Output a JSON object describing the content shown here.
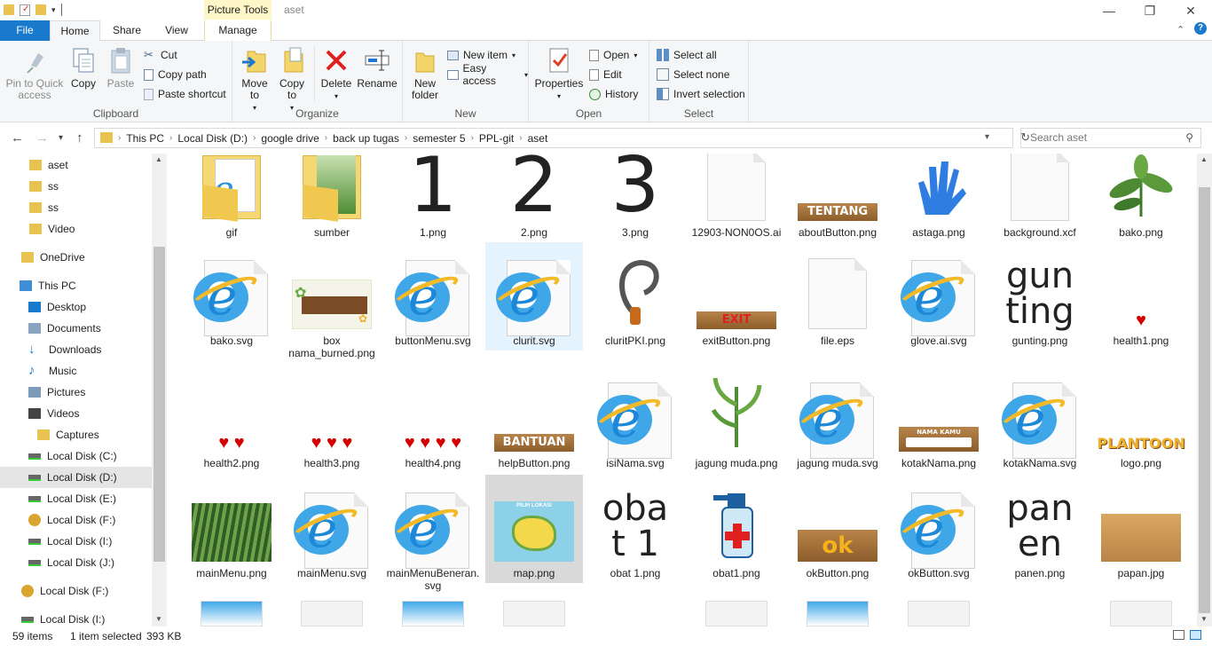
{
  "window": {
    "title": "aset",
    "context_tab": "Picture Tools",
    "minimize": "—",
    "restore": "❐",
    "close": "✕"
  },
  "tabs": [
    "File",
    "Home",
    "Share",
    "View",
    "Manage"
  ],
  "ribbon": {
    "clipboard": {
      "label": "Clipboard",
      "pin": "Pin to Quick access",
      "copy": "Copy",
      "paste": "Paste",
      "cut": "Cut",
      "copy_path": "Copy path",
      "paste_shortcut": "Paste shortcut"
    },
    "organize": {
      "label": "Organize",
      "move_to": "Move to",
      "copy_to": "Copy to",
      "delete": "Delete",
      "rename": "Rename"
    },
    "new": {
      "label": "New",
      "new_folder": "New folder",
      "new_item": "New item",
      "easy_access": "Easy access"
    },
    "open": {
      "label": "Open",
      "properties": "Properties",
      "open": "Open",
      "edit": "Edit",
      "history": "History"
    },
    "select": {
      "label": "Select",
      "select_all": "Select all",
      "select_none": "Select none",
      "invert": "Invert selection"
    }
  },
  "address": {
    "crumbs": [
      "This PC",
      "Local Disk (D:)",
      "google drive",
      "back up tugas",
      "semester 5",
      "PPL-git",
      "aset"
    ],
    "search_placeholder": "Search aset"
  },
  "nav": [
    {
      "label": "aset",
      "icon": "folder-icon"
    },
    {
      "label": "ss",
      "icon": "folder-icon"
    },
    {
      "label": "ss",
      "icon": "folder-icon"
    },
    {
      "label": "Video",
      "icon": "folder-icon"
    },
    {
      "label": "OneDrive",
      "icon": "folder-icon"
    },
    {
      "label": "This PC",
      "icon": "computer-icon"
    },
    {
      "label": "Desktop",
      "icon": "desktop-icon"
    },
    {
      "label": "Documents",
      "icon": "documents-icon"
    },
    {
      "label": "Downloads",
      "icon": "downloads-icon"
    },
    {
      "label": "Music",
      "icon": "music-icon"
    },
    {
      "label": "Pictures",
      "icon": "pictures-icon"
    },
    {
      "label": "Videos",
      "icon": "videos-icon"
    },
    {
      "label": "Captures",
      "icon": "folder-icon"
    },
    {
      "label": "Local Disk (C:)",
      "icon": "drive-icon"
    },
    {
      "label": "Local Disk (D:)",
      "icon": "drive-icon"
    },
    {
      "label": "Local Disk (E:)",
      "icon": "drive-icon"
    },
    {
      "label": "Local Disk (F:)",
      "icon": "disc-icon"
    },
    {
      "label": "Local Disk (I:)",
      "icon": "drive-icon"
    },
    {
      "label": "Local Disk (J:)",
      "icon": "drive-icon"
    },
    {
      "label": "Local Disk (F:)",
      "icon": "disc-icon"
    },
    {
      "label": "Local Disk (I:)",
      "icon": "drive-icon"
    }
  ],
  "files": [
    {
      "name": "gif",
      "thumb": "folder-ie"
    },
    {
      "name": "sumber",
      "thumb": "folder-plant"
    },
    {
      "name": "1.png",
      "thumb": "text",
      "text": "1"
    },
    {
      "name": "2.png",
      "thumb": "text",
      "text": "2"
    },
    {
      "name": "3.png",
      "thumb": "text",
      "text": "3"
    },
    {
      "name": "12903-NON0OS.ai",
      "thumb": "blank"
    },
    {
      "name": "aboutButton.png",
      "thumb": "wood",
      "text": "TENTANG"
    },
    {
      "name": "astaga.png",
      "thumb": "glove"
    },
    {
      "name": "background.xcf",
      "thumb": "blank"
    },
    {
      "name": "bako.png",
      "thumb": "plant"
    },
    {
      "name": "bako.svg",
      "thumb": "ie"
    },
    {
      "name": "box nama_burned.png",
      "thumb": "board"
    },
    {
      "name": "buttonMenu.svg",
      "thumb": "ie"
    },
    {
      "name": "clurit.svg",
      "thumb": "ie"
    },
    {
      "name": "cluritPKI.png",
      "thumb": "sickle"
    },
    {
      "name": "exitButton.png",
      "thumb": "wood",
      "text": "EXIT"
    },
    {
      "name": "file.eps",
      "thumb": "blank"
    },
    {
      "name": "glove.ai.svg",
      "thumb": "ie"
    },
    {
      "name": "gunting.png",
      "thumb": "bigtext",
      "text": "gun ting"
    },
    {
      "name": "health1.png",
      "thumb": "hearts",
      "text": "♥"
    },
    {
      "name": "health2.png",
      "thumb": "hearts",
      "text": "♥ ♥"
    },
    {
      "name": "health3.png",
      "thumb": "hearts",
      "text": "♥ ♥ ♥"
    },
    {
      "name": "health4.png",
      "thumb": "hearts",
      "text": "♥ ♥ ♥ ♥"
    },
    {
      "name": "helpButton.png",
      "thumb": "wood",
      "text": "BANTUAN"
    },
    {
      "name": "isiNama.svg",
      "thumb": "ie"
    },
    {
      "name": "jagung muda.png",
      "thumb": "corn"
    },
    {
      "name": "jagung muda.svg",
      "thumb": "ie"
    },
    {
      "name": "kotakNama.png",
      "thumb": "woodbox",
      "text": "NAMA KAMU"
    },
    {
      "name": "kotakNama.svg",
      "thumb": "ie"
    },
    {
      "name": "logo.png",
      "thumb": "logo",
      "text": "PLANTOON"
    },
    {
      "name": "mainMenu.png",
      "thumb": "field"
    },
    {
      "name": "mainMenu.svg",
      "thumb": "ie"
    },
    {
      "name": "mainMenuBeneran.svg",
      "thumb": "ie"
    },
    {
      "name": "map.png",
      "thumb": "map",
      "text": "PILIH LOKASI"
    },
    {
      "name": "obat 1.png",
      "thumb": "bigtext",
      "text": "obat 1"
    },
    {
      "name": "obat1.png",
      "thumb": "spray"
    },
    {
      "name": "okButton.png",
      "thumb": "wood",
      "text": "ok"
    },
    {
      "name": "okButton.svg",
      "thumb": "ie"
    },
    {
      "name": "panen.png",
      "thumb": "bigtext",
      "text": "pan en"
    },
    {
      "name": "papan.jpg",
      "thumb": "plank"
    }
  ],
  "status": {
    "count": "59 items",
    "selection": "1 item selected",
    "size": "393 KB"
  }
}
